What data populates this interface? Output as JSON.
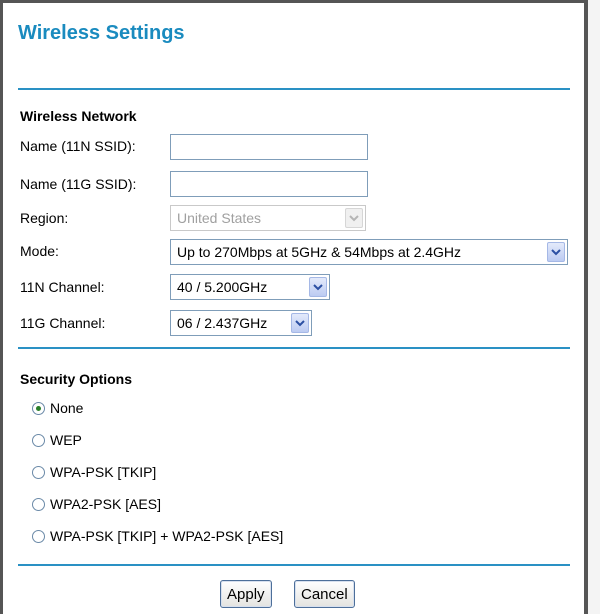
{
  "page": {
    "title": "Wireless Settings"
  },
  "wireless_network": {
    "heading": "Wireless Network",
    "ssid_11n": {
      "label": "Name (11N SSID):",
      "value": ""
    },
    "ssid_11g": {
      "label": "Name (11G SSID):",
      "value": ""
    },
    "region": {
      "label": "Region:",
      "value": "United States",
      "disabled": true
    },
    "mode": {
      "label": "Mode:",
      "value": "Up to 270Mbps at 5GHz & 54Mbps at 2.4GHz"
    },
    "channel_11n": {
      "label": "11N Channel:",
      "value": "40 / 5.200GHz"
    },
    "channel_11g": {
      "label": "11G Channel:",
      "value": "06 / 2.437GHz"
    }
  },
  "security": {
    "heading": "Security Options",
    "options": [
      {
        "label": "None",
        "checked": true
      },
      {
        "label": "WEP",
        "checked": false
      },
      {
        "label": "WPA-PSK [TKIP]",
        "checked": false
      },
      {
        "label": "WPA2-PSK [AES]",
        "checked": false
      },
      {
        "label": "WPA-PSK [TKIP] + WPA2-PSK [AES]",
        "checked": false
      }
    ]
  },
  "buttons": {
    "apply": "Apply",
    "cancel": "Cancel"
  },
  "colors": {
    "title": "#1a8bbf",
    "rule": "#2a91c4",
    "selected_radio": "#2a7f2a"
  },
  "icons": {
    "select_arrow": "chevron-down-icon"
  }
}
